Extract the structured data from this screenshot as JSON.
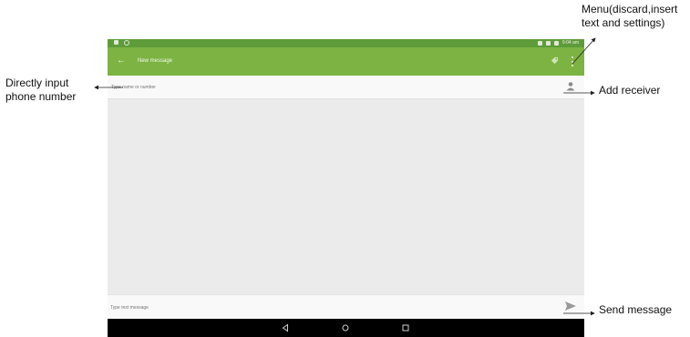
{
  "device": {
    "status_time": "9:04 am",
    "toolbar": {
      "title": "New message"
    },
    "recipient": {
      "placeholder": "Type name or number"
    },
    "compose": {
      "placeholder": "Type text message"
    }
  },
  "annotations": {
    "menu": [
      "Menu(discard,insert",
      "text and settings)"
    ],
    "direct_input": [
      "Directly input",
      "phone number"
    ],
    "add_receiver": "Add receiver",
    "send_message": "Send message"
  },
  "colors": {
    "toolbar": "#7cb342",
    "status_bar": "#5e9b39",
    "nav_bar": "#000000",
    "background": "#ebebeb"
  },
  "icons": [
    "back-arrow-icon",
    "attachment-tag-icon",
    "overflow-menu-icon",
    "add-contact-icon",
    "send-icon",
    "nav-back-icon",
    "nav-home-icon",
    "nav-recents-icon"
  ]
}
